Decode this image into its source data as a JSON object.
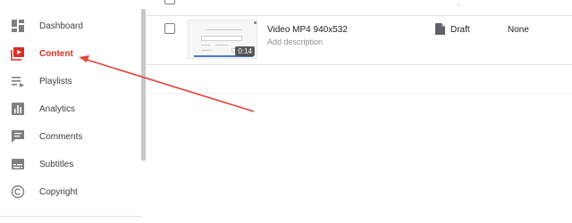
{
  "sidebar": {
    "items": [
      {
        "label": "Dashboard",
        "icon": "dashboard-icon",
        "active": false
      },
      {
        "label": "Content",
        "icon": "content-icon",
        "active": true
      },
      {
        "label": "Playlists",
        "icon": "playlists-icon",
        "active": false
      },
      {
        "label": "Analytics",
        "icon": "analytics-icon",
        "active": false
      },
      {
        "label": "Comments",
        "icon": "comments-icon",
        "active": false
      },
      {
        "label": "Subtitles",
        "icon": "subtitles-icon",
        "active": false
      },
      {
        "label": "Copyright",
        "icon": "copyright-icon",
        "active": false
      }
    ]
  },
  "videos": [
    {
      "title": "Video MP4 940x532",
      "description_placeholder": "Add description",
      "duration": "0:14",
      "visibility": "Draft",
      "restrictions": "None"
    }
  ],
  "colors": {
    "active_red": "#d93025",
    "annotation_arrow": "#e0463b",
    "icon_gray": "#7f7f7f"
  }
}
